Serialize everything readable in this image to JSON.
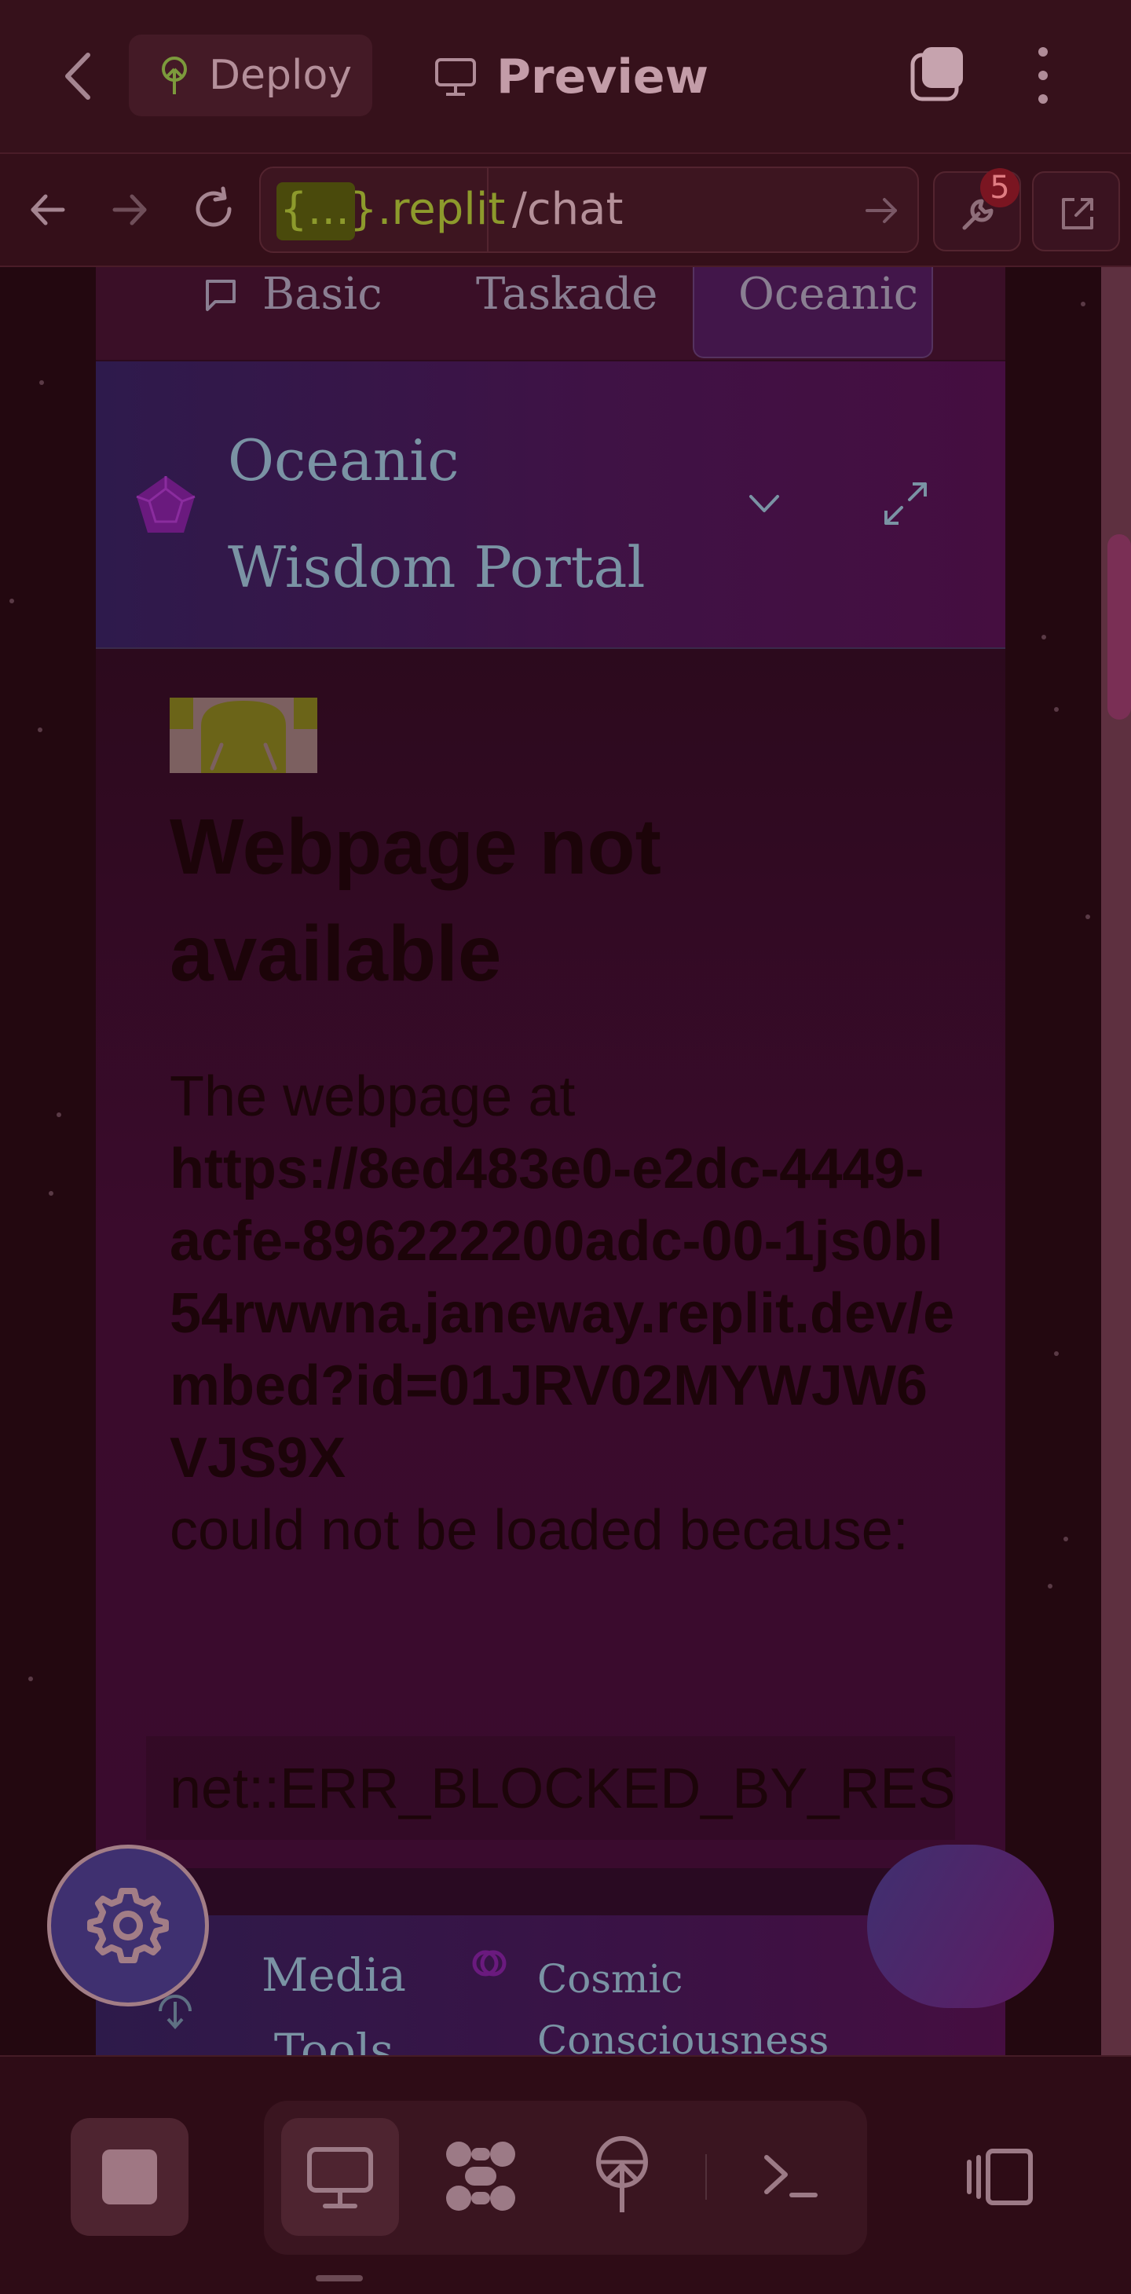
{
  "topbar": {
    "deploy_label": "Deploy",
    "preview_label": "Preview"
  },
  "browser": {
    "url_host": "{...}.replit",
    "url_path": "/chat",
    "badge_count": "5"
  },
  "portal": {
    "tabs": [
      {
        "label": "Basic"
      },
      {
        "label": "Taskade"
      },
      {
        "label": "Oceanic"
      }
    ],
    "title": "Oceanic Wisdom Portal",
    "nav_items": [
      {
        "label": "Media Tools"
      },
      {
        "label": "Cosmic Consciousness Portal"
      }
    ]
  },
  "error_page": {
    "title": "Webpage not available",
    "intro": "The webpage at",
    "url": "https://8ed483e0-e2dc-4449-acfe-896222200adc-00-1js0bl54rwwna.janeway.replit.dev/embed?id=01JRV02MYWJW6VJS9X",
    "after_url": "could not be loaded because:",
    "error_code": "net::ERR_BLOCKED_BY_RESPONSE"
  },
  "colors": {
    "badge": "#7a1521",
    "accent_purple": "#3f3070",
    "portal_title": "#7a93a4"
  }
}
